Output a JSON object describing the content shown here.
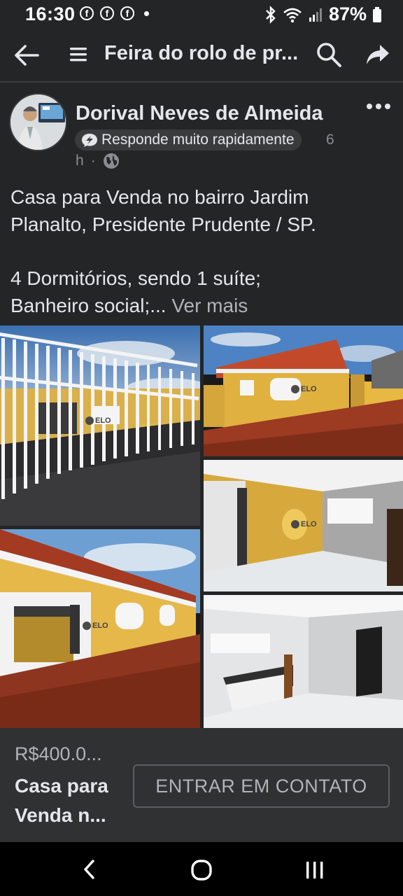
{
  "status_bar": {
    "time": "16:30",
    "notif_icons": [
      "facebook-icon",
      "facebook-icon",
      "facebook-icon"
    ],
    "battery": "87%"
  },
  "app_bar": {
    "title": "Feira do rolo de pr..."
  },
  "post": {
    "author": "Dorival Neves de Almeida",
    "badge": "Responde muito rapidamente",
    "badge_count": "6",
    "time": "h",
    "meta_sep": "·",
    "text_line_1": "Casa para Venda no bairro Jardim",
    "text_line_2": "Planalto,  Presidente Prudente / SP.",
    "text_line_3": "4 Dormitórios, sendo 1 suíte;",
    "text_line_4": "Banheiro social;...",
    "see_more": "Ver mais"
  },
  "photo_logo": "ELO",
  "listing": {
    "price": "R$400.0...",
    "title": "Casa para Venda n...",
    "contact_button": "ENTRAR EM CONTATO"
  },
  "colors": {
    "background": "#242526",
    "card": "#303133",
    "text": "#e4e6eb",
    "muted": "#b0b3b8"
  }
}
